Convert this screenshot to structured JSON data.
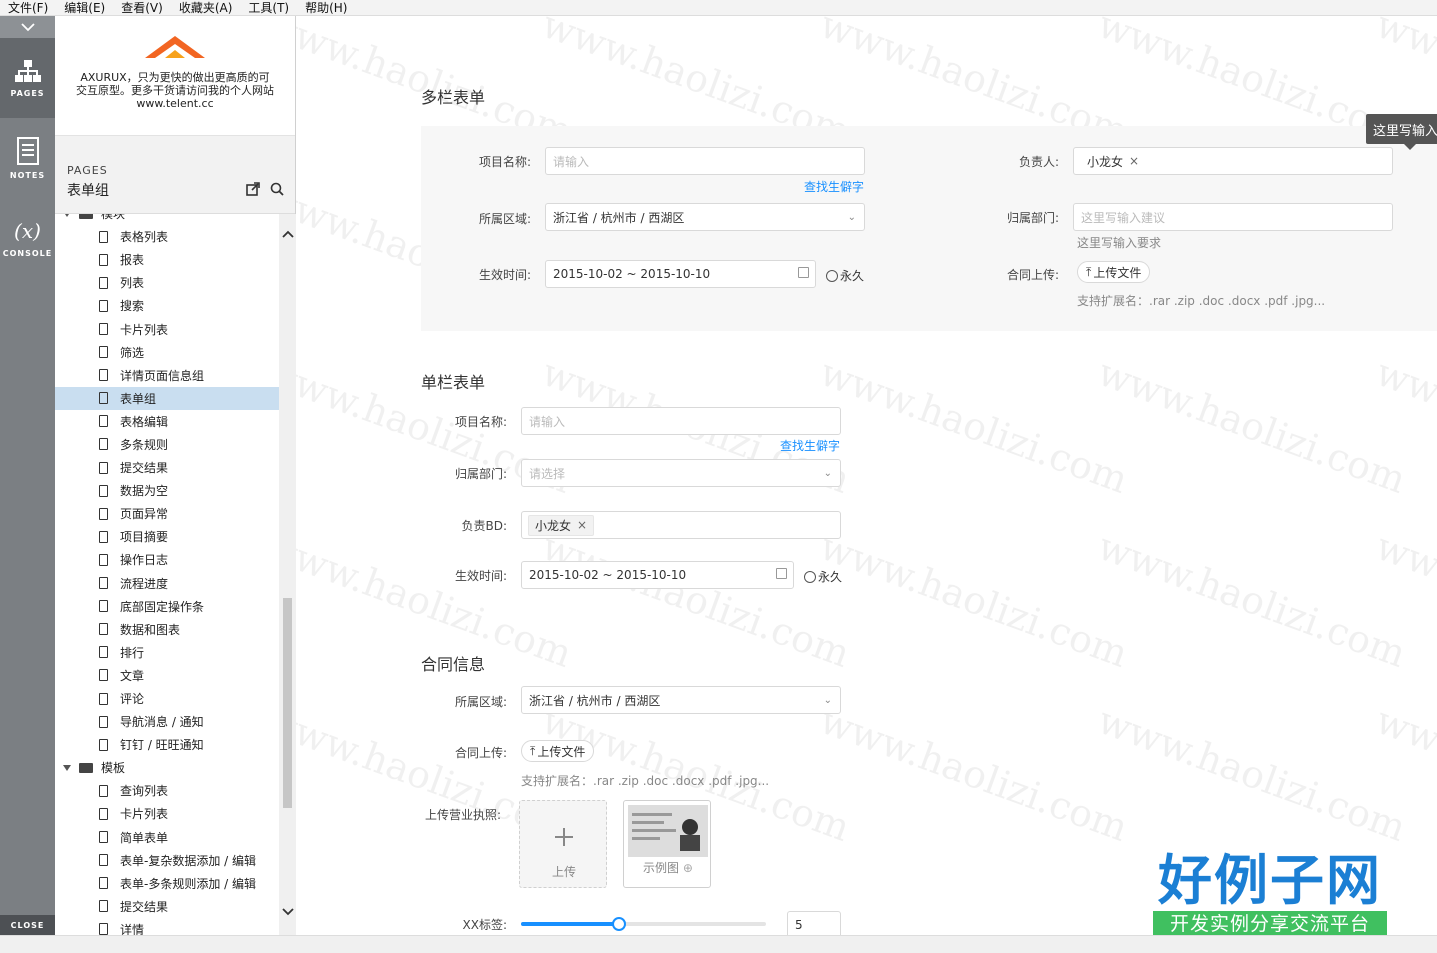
{
  "menu": [
    "文件(F)",
    "编辑(E)",
    "查看(V)",
    "收藏夹(A)",
    "工具(T)",
    "帮助(H)"
  ],
  "rail": {
    "pages": "PAGES",
    "notes": "NOTES",
    "console": "CONSOLE",
    "console_glyph": "(x)",
    "close": "CLOSE"
  },
  "logo": {
    "text": "AXURUX，只为更快的做出更高质的可交互原型。更多干货请访问我的个人网站",
    "url": "www.telent.cc"
  },
  "pages_panel": {
    "label": "PAGES",
    "title": "表单组"
  },
  "tree": [
    {
      "type": "folder",
      "label": "模块"
    },
    {
      "type": "page",
      "label": "表格列表"
    },
    {
      "type": "page",
      "label": "报表"
    },
    {
      "type": "page",
      "label": "列表"
    },
    {
      "type": "page",
      "label": "搜索"
    },
    {
      "type": "page",
      "label": "卡片列表"
    },
    {
      "type": "page",
      "label": "筛选"
    },
    {
      "type": "page",
      "label": "详情页面信息组"
    },
    {
      "type": "page",
      "label": "表单组",
      "selected": true
    },
    {
      "type": "page",
      "label": "表格编辑"
    },
    {
      "type": "page",
      "label": "多条规则"
    },
    {
      "type": "page",
      "label": "提交结果"
    },
    {
      "type": "page",
      "label": "数据为空"
    },
    {
      "type": "page",
      "label": "页面异常"
    },
    {
      "type": "page",
      "label": "项目摘要"
    },
    {
      "type": "page",
      "label": "操作日志"
    },
    {
      "type": "page",
      "label": "流程进度"
    },
    {
      "type": "page",
      "label": "底部固定操作条"
    },
    {
      "type": "page",
      "label": "数据和图表"
    },
    {
      "type": "page",
      "label": "排行"
    },
    {
      "type": "page",
      "label": "文章"
    },
    {
      "type": "page",
      "label": "评论"
    },
    {
      "type": "page",
      "label": "导航消息 / 通知"
    },
    {
      "type": "page",
      "label": "钉钉 / 旺旺通知"
    },
    {
      "type": "folder",
      "label": "模板"
    },
    {
      "type": "page",
      "label": "查询列表"
    },
    {
      "type": "page",
      "label": "卡片列表"
    },
    {
      "type": "page",
      "label": "简单表单"
    },
    {
      "type": "page",
      "label": "表单-复杂数据添加 / 编辑"
    },
    {
      "type": "page",
      "label": "表单-多条规则添加 / 编辑"
    },
    {
      "type": "page",
      "label": "提交结果"
    },
    {
      "type": "page",
      "label": "详情"
    }
  ],
  "multi": {
    "title": "多栏表单",
    "project_label": "项目名称:",
    "project_placeholder": "请输入",
    "find_link": "查找生僻字",
    "region_label": "所属区域:",
    "region_value": "浙江省 / 杭州市 / 西湖区",
    "date_label": "生效时间:",
    "date_value": "2015-10-02 ~ 2015-10-10",
    "forever": "永久",
    "owner_label": "负责人:",
    "owner_tag": "小龙女",
    "dept_label": "归属部门:",
    "dept_placeholder": "这里写输入建议",
    "dept_hint": "这里写输入要求",
    "contract_label": "合同上传:",
    "upload_btn": "上传文件",
    "ext_hint": "支持扩展名：.rar .zip .doc .docx .pdf .jpg...",
    "tooltip": "这里写输入"
  },
  "single": {
    "title": "单栏表单",
    "project_label": "项目名称:",
    "project_placeholder": "请输入",
    "find_link": "查找生僻字",
    "dept_label": "归属部门:",
    "dept_placeholder": "请选择",
    "bd_label": "负责BD:",
    "bd_tag": "小龙女",
    "date_label": "生效时间:",
    "date_value": "2015-10-02 ~ 2015-10-10",
    "forever": "永久"
  },
  "contract": {
    "title": "合同信息",
    "region_label": "所属区域:",
    "region_value": "浙江省 / 杭州市 / 西湖区",
    "upload_label": "合同上传:",
    "upload_btn": "上传文件",
    "ext_hint": "支持扩展名：.rar .zip .doc .docx .pdf .jpg...",
    "license_label": "上传营业执照:",
    "upload_card": "上传",
    "sample_card": "示例图",
    "xx_label": "XX标签:",
    "slider_value": "5",
    "slider_fraction": 0.4
  },
  "watermark": "www.haolizi.com",
  "brand": {
    "main": "好例子网",
    "sub": "开发实例分享交流平台"
  },
  "colors": {
    "accent": "#1890ff",
    "rail": "#7b7f83",
    "selected": "#c9def0"
  }
}
